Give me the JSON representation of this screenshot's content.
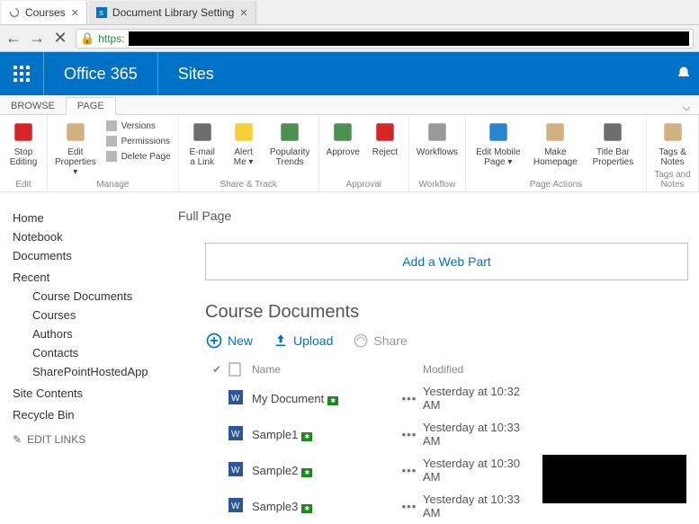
{
  "browser": {
    "tabs": [
      {
        "title": "Courses",
        "active": true,
        "icon": "spinner-icon"
      },
      {
        "title": "Document Library Setting",
        "active": false,
        "icon": "sharepoint-icon"
      }
    ],
    "url_protocol": "https:"
  },
  "suite": {
    "brand": "Office 365",
    "app": "Sites"
  },
  "contextual_tabs": {
    "items": [
      "BROWSE",
      "PAGE"
    ],
    "active": "PAGE"
  },
  "ribbon": {
    "groups": [
      {
        "label": "Edit",
        "items": [
          {
            "kind": "big",
            "icon": "#c00",
            "label": "Stop Editing",
            "sub": "▾"
          }
        ]
      },
      {
        "label": "Manage",
        "items": [
          {
            "kind": "big",
            "icon": "#c9a36a",
            "label": "Edit Properties ▾"
          },
          {
            "kind": "stack",
            "small": [
              {
                "icon": "versions-icon",
                "label": "Versions"
              },
              {
                "icon": "permissions-icon",
                "label": "Permissions"
              },
              {
                "icon": "delete-icon",
                "label": "Delete Page"
              }
            ]
          }
        ]
      },
      {
        "label": "Share & Track",
        "items": [
          {
            "kind": "big",
            "icon": "#555",
            "label": "E-mail a Link"
          },
          {
            "kind": "big",
            "icon": "#f5c518",
            "label": "Alert Me ▾"
          },
          {
            "kind": "big",
            "icon": "#2e7d32",
            "label": "Popularity Trends"
          }
        ]
      },
      {
        "label": "Approval",
        "items": [
          {
            "kind": "big",
            "icon": "#2e7d32",
            "label": "Approve"
          },
          {
            "kind": "big",
            "icon": "#c00",
            "label": "Reject"
          }
        ]
      },
      {
        "label": "Workflow",
        "items": [
          {
            "kind": "big",
            "icon": "#888",
            "label": "Workflows"
          }
        ]
      },
      {
        "label": "Page Actions",
        "items": [
          {
            "kind": "big",
            "icon": "#0072c6",
            "label": "Edit Mobile Page ▾"
          },
          {
            "kind": "big",
            "icon": "#c9a36a",
            "label": "Make Homepage"
          },
          {
            "kind": "big",
            "icon": "#555",
            "label": "Title Bar Properties"
          }
        ]
      },
      {
        "label": "Tags and Notes",
        "items": [
          {
            "kind": "big",
            "icon": "#c9a36a",
            "label": "Tags & Notes"
          }
        ]
      }
    ]
  },
  "leftnav": {
    "top": [
      "Home",
      "Notebook",
      "Documents"
    ],
    "recent_header": "Recent",
    "recent": [
      "Course Documents",
      "Courses",
      "Authors",
      "Contacts",
      "SharePointHostedApp"
    ],
    "bottom": [
      "Site Contents",
      "Recycle Bin"
    ],
    "edit": "EDIT LINKS"
  },
  "main": {
    "mode": "Full Page",
    "add_webpart": "Add a Web Part",
    "webpart_title": "Course Documents",
    "tools": {
      "new": "New",
      "upload": "Upload",
      "share": "Share"
    },
    "columns": {
      "name": "Name",
      "modified": "Modified"
    },
    "rows": [
      {
        "name": "My Document",
        "new": true,
        "modified": "Yesterday at 10:32 AM"
      },
      {
        "name": "Sample1",
        "new": true,
        "modified": "Yesterday at 10:33 AM"
      },
      {
        "name": "Sample2",
        "new": true,
        "modified": "Yesterday at 10:30 AM"
      },
      {
        "name": "Sample3",
        "new": true,
        "modified": "Yesterday at 10:33 AM"
      }
    ]
  }
}
